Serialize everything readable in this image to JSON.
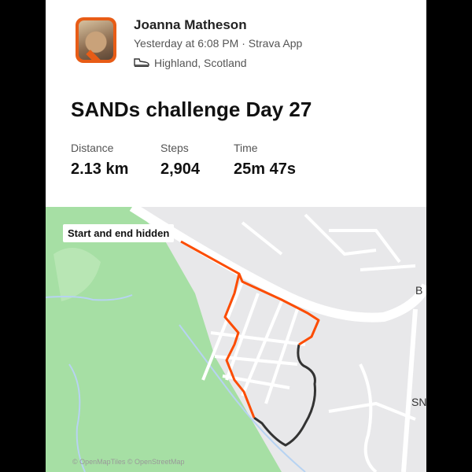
{
  "athlete": {
    "name": "Joanna Matheson",
    "meta": "Yesterday at 6:08 PM · Strava App",
    "location": "Highland, Scotland",
    "activity_icon": "shoe-icon"
  },
  "activity": {
    "title": "SANDs challenge Day 27",
    "stats": [
      {
        "label": "Distance",
        "value": "2.13 km"
      },
      {
        "label": "Steps",
        "value": "2,904"
      },
      {
        "label": "Time",
        "value": "25m 47s"
      }
    ]
  },
  "map": {
    "privacy_badge": "Start and end hidden",
    "attribution": "© OpenMapTiles © OpenStreetMap",
    "road_labels": [
      "B",
      "SN"
    ]
  },
  "colors": {
    "route_visible": "#fc4c02",
    "route_hidden": "#333333",
    "park": "#a6dfa4"
  }
}
